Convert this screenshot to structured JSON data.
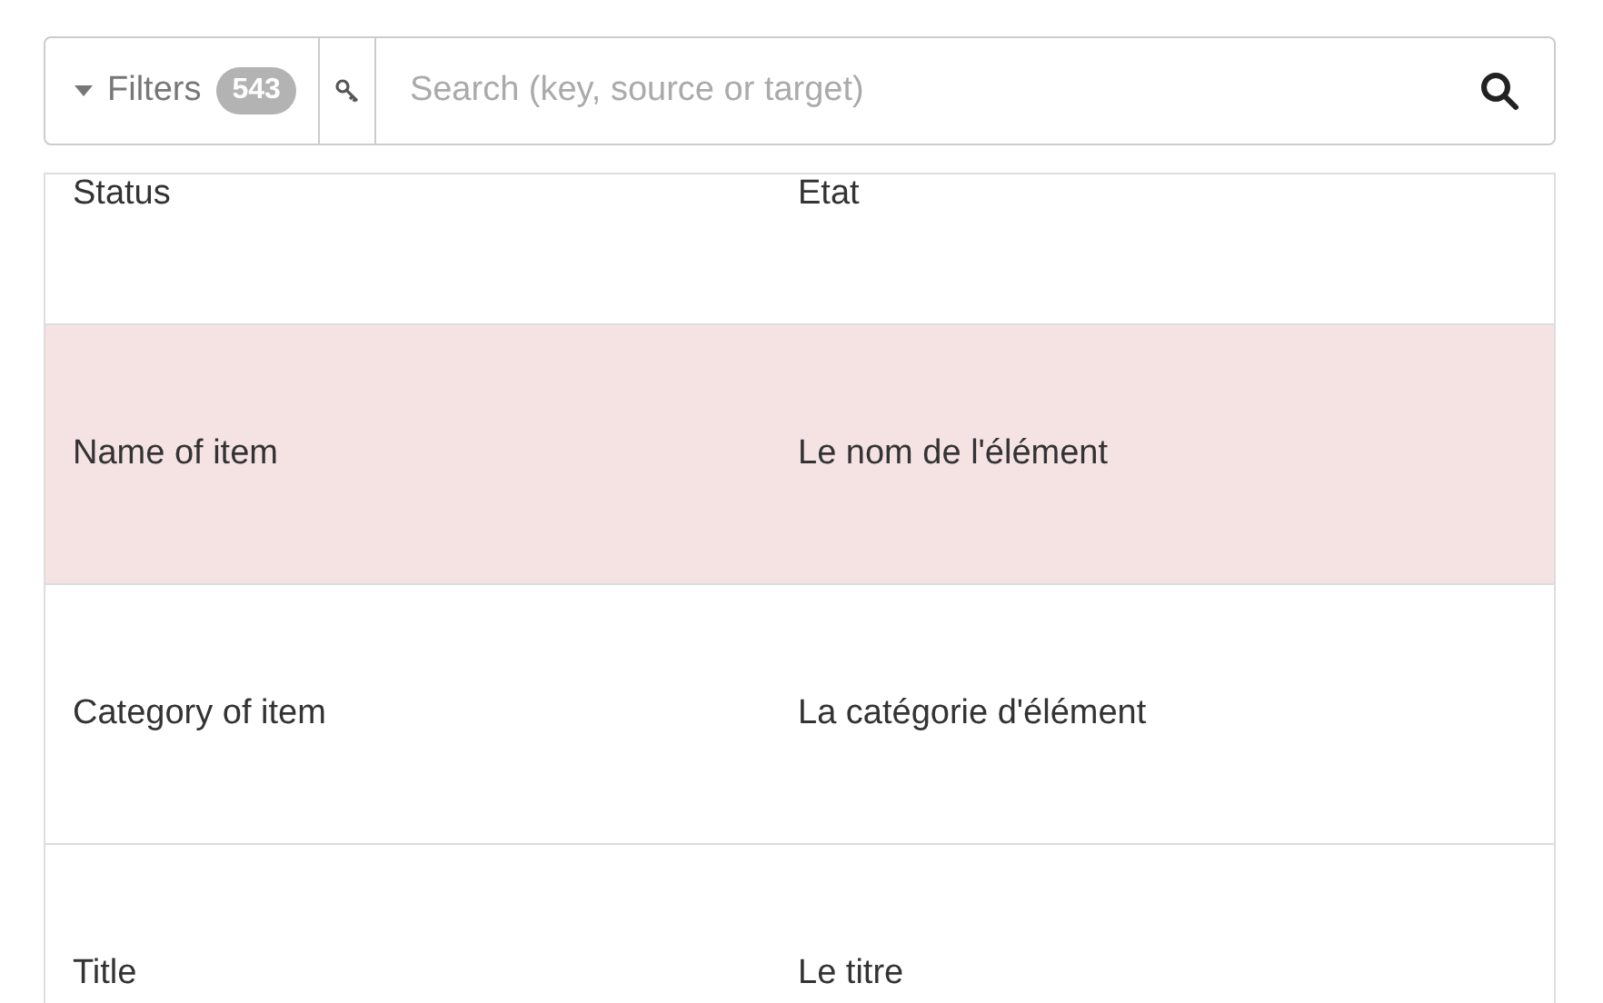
{
  "filter_bar": {
    "filters_label": "Filters",
    "filters_count": "543",
    "search": {
      "placeholder": "Search (key, source or target)"
    }
  },
  "rows": [
    {
      "source": "Status",
      "target": "Etat",
      "selected": false
    },
    {
      "source": "Name of item",
      "target": "Le nom de l'élément",
      "selected": true
    },
    {
      "source": "Category of item",
      "target": "La catégorie d'élément",
      "selected": false
    },
    {
      "source": "Title",
      "target": "Le titre",
      "selected": false
    }
  ]
}
